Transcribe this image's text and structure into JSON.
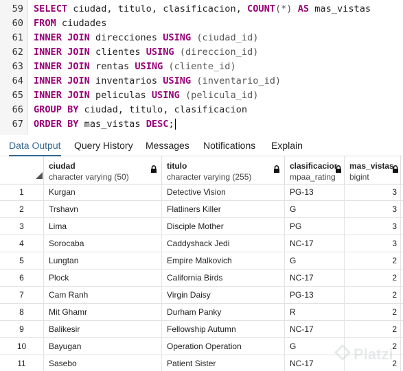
{
  "editor": {
    "lines": [
      {
        "num": "59",
        "tokens": [
          {
            "t": "SELECT",
            "k": "kw"
          },
          {
            "t": " ciudad, titulo, clasificacion, "
          },
          {
            "t": "COUNT",
            "k": "kw"
          },
          {
            "t": "(*)",
            "k": "p"
          },
          {
            "t": " "
          },
          {
            "t": "AS",
            "k": "kw"
          },
          {
            "t": " mas_vistas"
          }
        ]
      },
      {
        "num": "60",
        "tokens": [
          {
            "t": "FROM",
            "k": "kw"
          },
          {
            "t": " ciudades"
          }
        ]
      },
      {
        "num": "61",
        "tokens": [
          {
            "t": "INNER JOIN",
            "k": "kw"
          },
          {
            "t": " direcciones "
          },
          {
            "t": "USING",
            "k": "kw"
          },
          {
            "t": " (ciudad_id)",
            "k": "p"
          }
        ]
      },
      {
        "num": "62",
        "tokens": [
          {
            "t": "INNER JOIN",
            "k": "kw"
          },
          {
            "t": " clientes "
          },
          {
            "t": "USING",
            "k": "kw"
          },
          {
            "t": " (direccion_id)",
            "k": "p"
          }
        ]
      },
      {
        "num": "63",
        "tokens": [
          {
            "t": "INNER JOIN",
            "k": "kw"
          },
          {
            "t": " rentas "
          },
          {
            "t": "USING",
            "k": "kw"
          },
          {
            "t": " (cliente_id)",
            "k": "p"
          }
        ]
      },
      {
        "num": "64",
        "tokens": [
          {
            "t": "INNER JOIN",
            "k": "kw"
          },
          {
            "t": " inventarios "
          },
          {
            "t": "USING",
            "k": "kw"
          },
          {
            "t": " (inventario_id)",
            "k": "p"
          }
        ]
      },
      {
        "num": "65",
        "tokens": [
          {
            "t": "INNER JOIN",
            "k": "kw"
          },
          {
            "t": " peliculas "
          },
          {
            "t": "USING",
            "k": "kw"
          },
          {
            "t": " (pelicula_id)",
            "k": "p"
          }
        ]
      },
      {
        "num": "66",
        "tokens": [
          {
            "t": "GROUP BY",
            "k": "kw"
          },
          {
            "t": " ciudad, titulo, clasificacion"
          }
        ]
      },
      {
        "num": "67",
        "tokens": [
          {
            "t": "ORDER BY",
            "k": "kw"
          },
          {
            "t": " mas_vistas "
          },
          {
            "t": "DESC",
            "k": "kw"
          },
          {
            "t": ";"
          }
        ],
        "cursor": true
      }
    ]
  },
  "tabs": [
    {
      "label": "Data Output",
      "active": true,
      "name": "tab-data-output"
    },
    {
      "label": "Query History",
      "active": false,
      "name": "tab-query-history"
    },
    {
      "label": "Messages",
      "active": false,
      "name": "tab-messages"
    },
    {
      "label": "Notifications",
      "active": false,
      "name": "tab-notifications"
    },
    {
      "label": "Explain",
      "active": false,
      "name": "tab-explain"
    }
  ],
  "columns": [
    {
      "name": "ciudad",
      "type": "character varying (50)",
      "locked": true
    },
    {
      "name": "titulo",
      "type": "character varying (255)",
      "locked": true
    },
    {
      "name": "clasificacion",
      "type": "mpaa_rating",
      "locked": true
    },
    {
      "name": "mas_vistas",
      "type": "bigint",
      "locked": true
    }
  ],
  "rows": [
    {
      "n": "1",
      "cells": [
        "Kurgan",
        "Detective Vision",
        "PG-13",
        "3"
      ]
    },
    {
      "n": "2",
      "cells": [
        "Trshavn",
        "Flatliners Killer",
        "G",
        "3"
      ]
    },
    {
      "n": "3",
      "cells": [
        "Lima",
        "Disciple Mother",
        "PG",
        "3"
      ]
    },
    {
      "n": "4",
      "cells": [
        "Sorocaba",
        "Caddyshack Jedi",
        "NC-17",
        "3"
      ]
    },
    {
      "n": "5",
      "cells": [
        "Lungtan",
        "Empire Malkovich",
        "G",
        "2"
      ]
    },
    {
      "n": "6",
      "cells": [
        "Plock",
        "California Birds",
        "NC-17",
        "2"
      ]
    },
    {
      "n": "7",
      "cells": [
        "Cam Ranh",
        "Virgin Daisy",
        "PG-13",
        "2"
      ]
    },
    {
      "n": "8",
      "cells": [
        "Mit Ghamr",
        "Durham Panky",
        "R",
        "2"
      ]
    },
    {
      "n": "9",
      "cells": [
        "Balikesir",
        "Fellowship Autumn",
        "NC-17",
        "2"
      ]
    },
    {
      "n": "10",
      "cells": [
        "Bayugan",
        "Operation Operation",
        "G",
        "2"
      ]
    },
    {
      "n": "11",
      "cells": [
        "Sasebo",
        "Patient Sister",
        "NC-17",
        "2"
      ]
    }
  ],
  "watermark": {
    "text": "Platzi"
  }
}
